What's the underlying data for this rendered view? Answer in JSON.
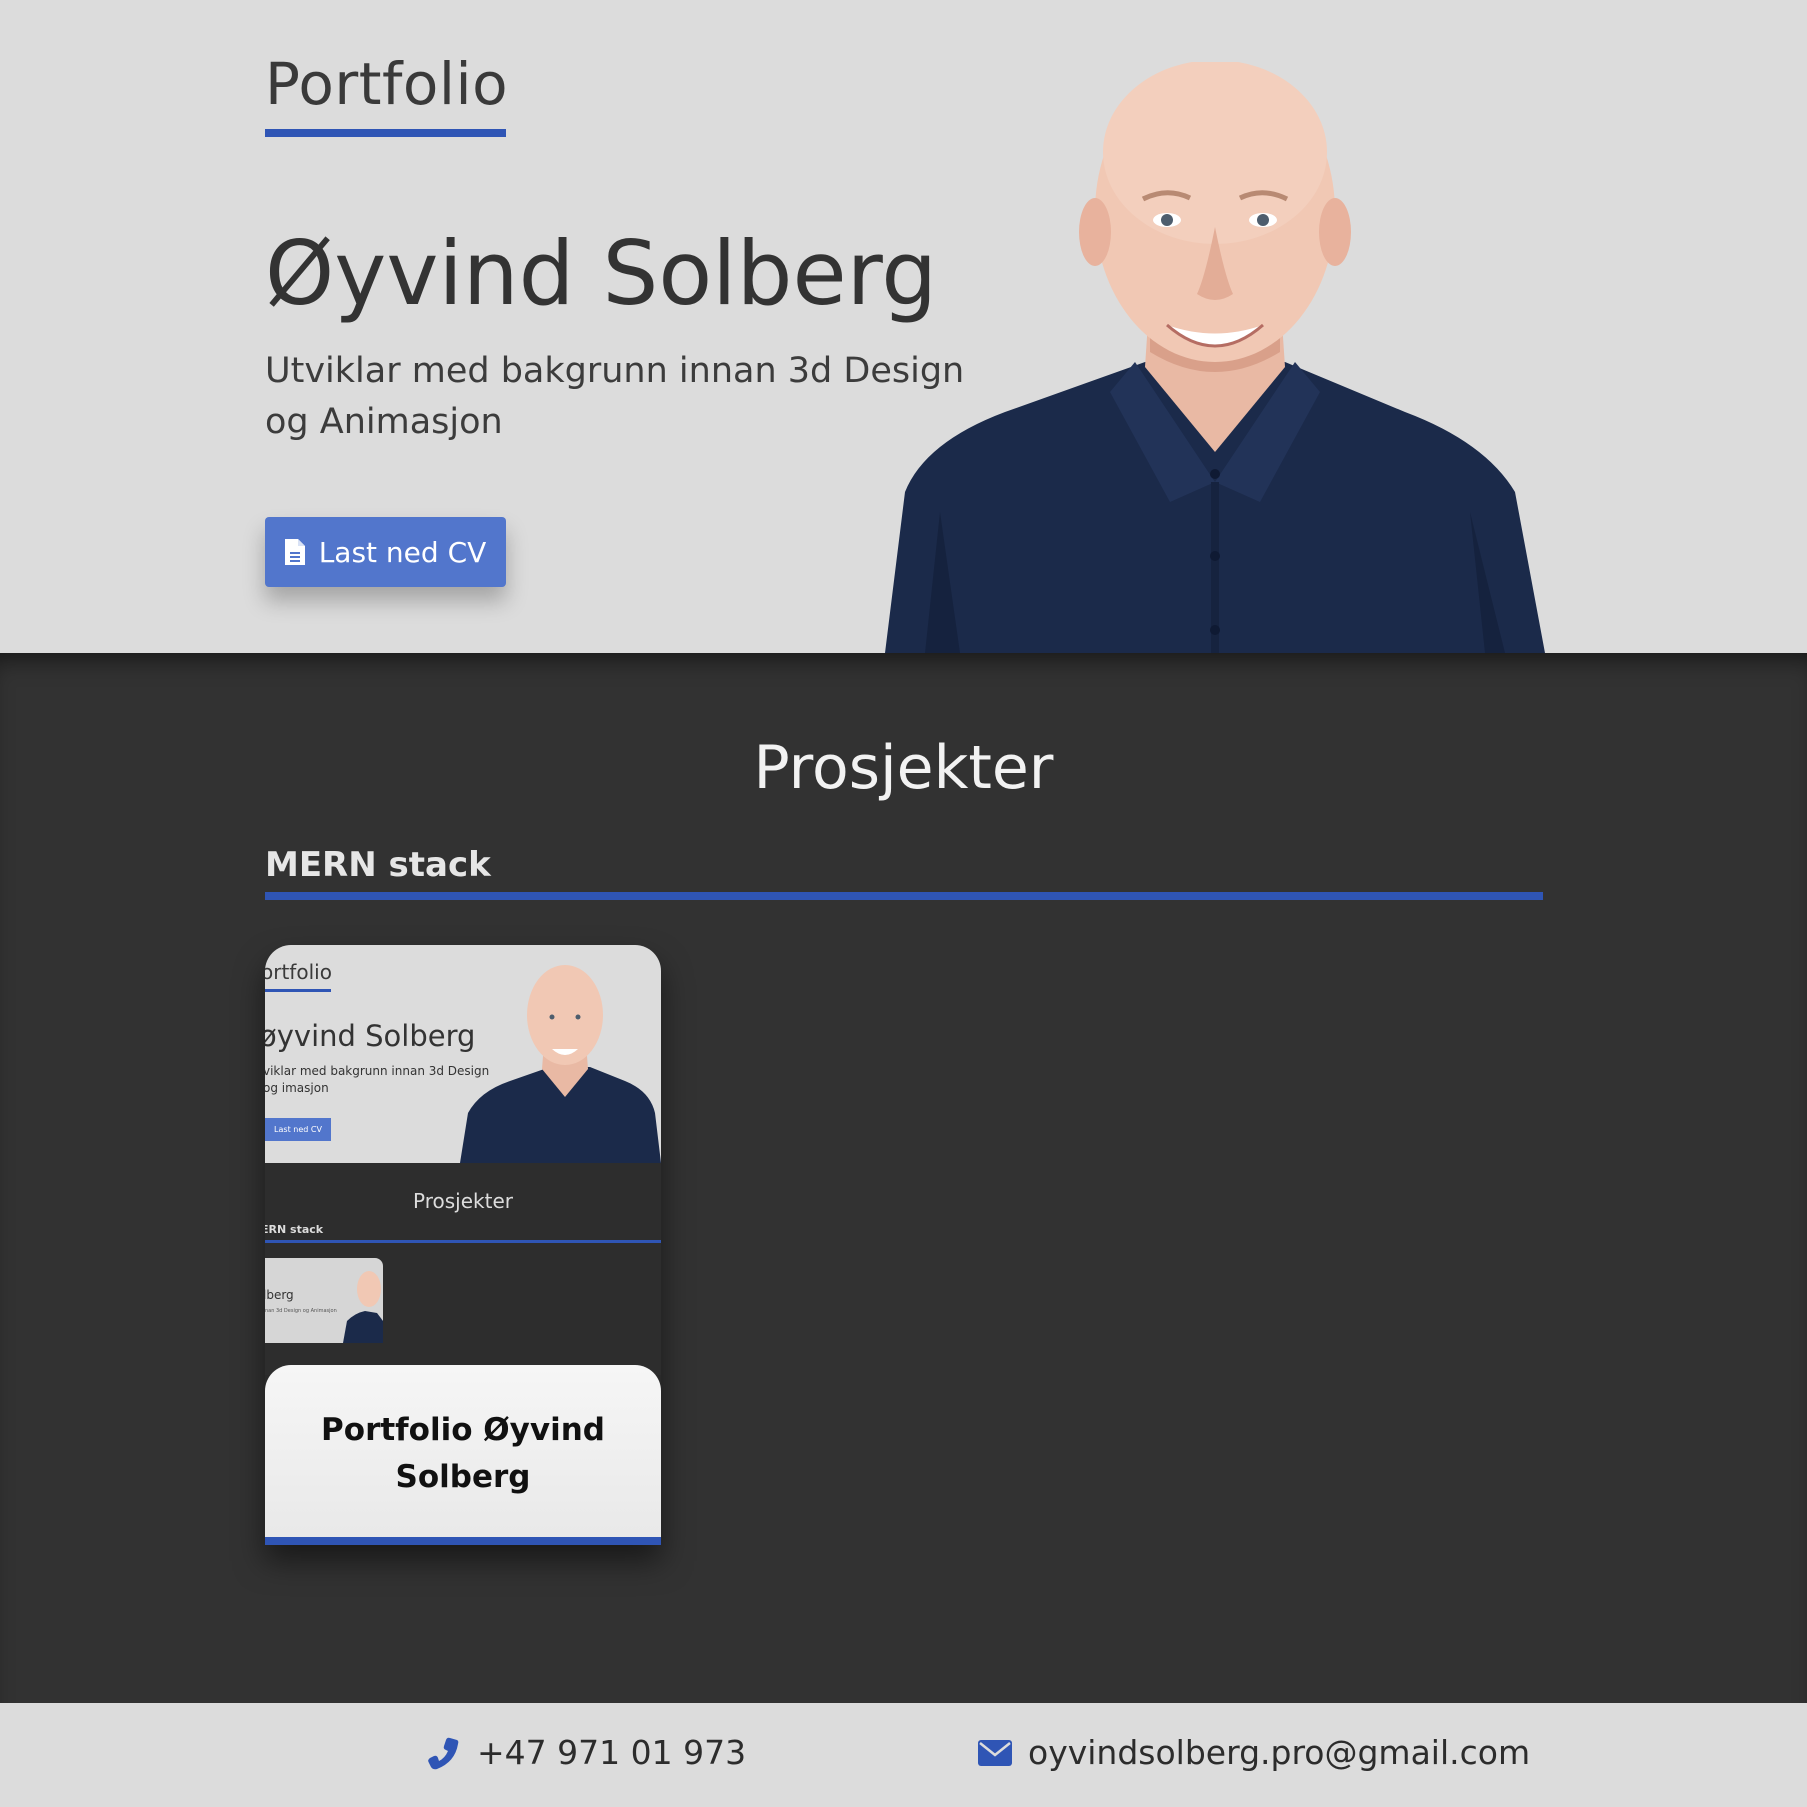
{
  "hero": {
    "brand": "Portfolio",
    "name": "Øyvind Solberg",
    "subtitle": "Utviklar med bakgrunn innan 3d Design og Animasjon",
    "cv_button": "Last ned CV"
  },
  "projects": {
    "title": "Prosjekter",
    "category": "MERN stack",
    "cards": [
      {
        "title": "Portfolio Øyvind Solberg",
        "thumb": {
          "brand": "ortfolio",
          "name": "øyvind Solberg",
          "subtitle": "viklar med bakgrunn innan 3d Design og imasjon",
          "button": "Last ned CV",
          "projects_title": "Prosjekter",
          "category": "ERN stack",
          "mini_name": "lberg",
          "mini_sub": "nan 3d Design og Animasjon"
        }
      }
    ]
  },
  "footer": {
    "phone": "+47 971 01 973",
    "email": "oyvindsolberg.pro@gmail.com"
  },
  "colors": {
    "accent": "#2f55b5",
    "button": "#5276cc",
    "hero_bg": "#dcdcdc",
    "projects_bg": "#323232"
  }
}
